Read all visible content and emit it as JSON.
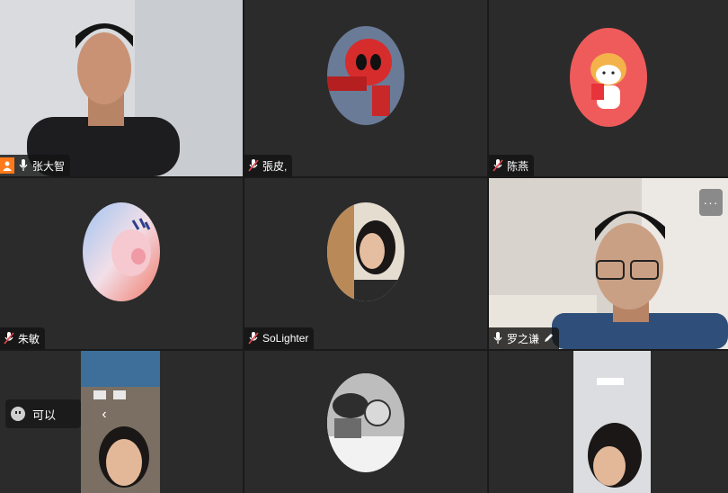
{
  "participants": [
    {
      "name": "张大智",
      "host": true,
      "muted": false
    },
    {
      "name": "張​皮,",
      "muted": true
    },
    {
      "name": "陈燕",
      "muted": true
    },
    {
      "name": "朱敏",
      "muted": true
    },
    {
      "name": "SoLighter",
      "muted": true
    },
    {
      "name": "罗之谦",
      "muted": false,
      "speaking": true
    }
  ],
  "chat": {
    "text": "可以"
  },
  "more_label": "···",
  "colors": {
    "active_border": "#23c36a",
    "host_badge": "#ff7a1a",
    "muted_mic": "#e5484d"
  }
}
